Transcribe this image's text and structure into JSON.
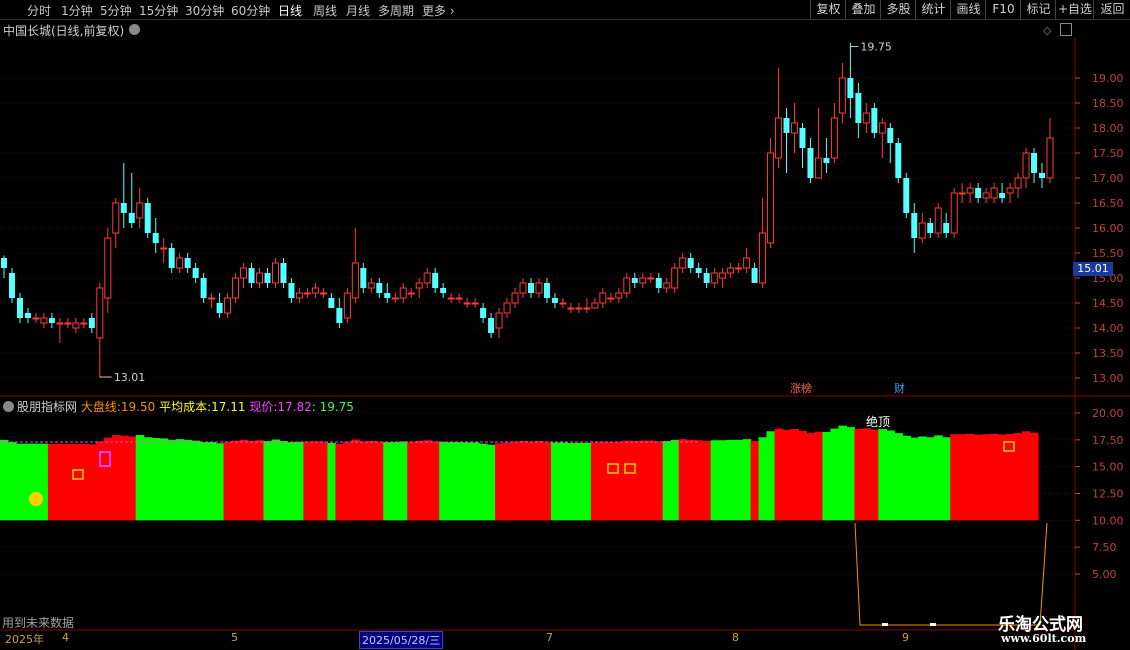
{
  "toolbar": {
    "periods": [
      "分时",
      "1分钟",
      "5分钟",
      "15分钟",
      "30分钟",
      "60分钟",
      "日线",
      "周线",
      "月线",
      "多周期",
      "更多"
    ],
    "active": "日线",
    "right_buttons": [
      "复权",
      "叠加",
      "多股",
      "统计",
      "画线",
      "F10",
      "标记",
      "+自选",
      "返回"
    ]
  },
  "chart": {
    "title": "中国长城(日线,前复权)",
    "current_price_label": "15.01",
    "high_marker": "19.75",
    "low_marker": "13.01",
    "event_labels": [
      "涨榜",
      "财"
    ]
  },
  "indicator": {
    "name": "股朋指标网",
    "dapanxian_label": "大盘线:",
    "dapanxian_value": "19.50",
    "avgcost_label": "平均成本:",
    "avgcost_value": "17.11",
    "price_label": "现价:",
    "price_value": "17.82",
    "last_value": ": 19.75",
    "annotation_top": "绝顶",
    "future_note": "用到未来数据"
  },
  "dates": {
    "year": "2025年",
    "months": [
      "4",
      "5",
      "7",
      "8",
      "9"
    ],
    "cursor_date": "2025/05/28/三"
  },
  "watermark": {
    "line1": "乐淘公式网",
    "line2": "www.60lt.com"
  },
  "colors": {
    "up": "#ff3a3a",
    "down": "#54ffff",
    "green": "#00ff00",
    "red": "#ff0000",
    "grid": "#8b0000",
    "axis_text": "#c04040"
  },
  "chart_data": {
    "type": "candlestick",
    "price_axis_ticks": [
      19.0,
      18.5,
      18.0,
      17.5,
      17.0,
      16.5,
      16.0,
      15.5,
      15.0,
      14.5,
      14.0,
      13.5,
      13.0
    ],
    "indicator_axis_ticks": [
      20.0,
      17.5,
      15.0,
      12.5,
      10.0,
      7.5,
      5.0
    ],
    "ylim": [
      12.9,
      19.8
    ],
    "candles": [
      [
        15.4,
        15.2,
        15.45,
        15.0
      ],
      [
        15.1,
        14.6,
        15.2,
        14.5
      ],
      [
        14.6,
        14.2,
        14.7,
        14.1
      ],
      [
        14.3,
        14.2,
        14.4,
        14.1
      ],
      [
        14.2,
        14.2,
        14.3,
        14.1
      ],
      [
        14.1,
        14.2,
        14.3,
        14.0
      ],
      [
        14.2,
        14.1,
        14.3,
        14.0
      ],
      [
        14.1,
        14.1,
        14.2,
        13.7
      ],
      [
        14.1,
        14.1,
        14.2,
        14.0
      ],
      [
        14.0,
        14.1,
        14.2,
        13.9
      ],
      [
        14.1,
        14.1,
        14.2,
        14.0
      ],
      [
        14.2,
        14.0,
        14.3,
        13.9
      ],
      [
        13.8,
        14.8,
        14.9,
        13.0
      ],
      [
        14.6,
        15.8,
        16.0,
        14.3
      ],
      [
        15.9,
        16.5,
        16.6,
        15.6
      ],
      [
        16.5,
        16.3,
        17.3,
        16.0
      ],
      [
        16.3,
        16.1,
        17.1,
        16.0
      ],
      [
        16.2,
        16.5,
        16.8,
        16.0
      ],
      [
        16.5,
        15.9,
        16.6,
        15.8
      ],
      [
        15.9,
        15.7,
        16.2,
        15.5
      ],
      [
        15.6,
        15.6,
        15.8,
        15.3
      ],
      [
        15.6,
        15.2,
        15.7,
        15.1
      ],
      [
        15.2,
        15.4,
        15.5,
        15.1
      ],
      [
        15.4,
        15.2,
        15.5,
        15.1
      ],
      [
        15.2,
        15.0,
        15.3,
        14.9
      ],
      [
        15.0,
        14.6,
        15.1,
        14.5
      ],
      [
        14.6,
        14.6,
        14.7,
        14.4
      ],
      [
        14.5,
        14.3,
        14.7,
        14.2
      ],
      [
        14.3,
        14.6,
        14.7,
        14.2
      ],
      [
        14.6,
        15.0,
        15.1,
        14.5
      ],
      [
        15.0,
        15.2,
        15.3,
        14.8
      ],
      [
        15.2,
        14.9,
        15.3,
        14.8
      ],
      [
        14.9,
        15.1,
        15.2,
        14.8
      ],
      [
        15.1,
        14.9,
        15.2,
        14.8
      ],
      [
        14.9,
        15.3,
        15.4,
        14.8
      ],
      [
        15.3,
        14.9,
        15.4,
        14.8
      ],
      [
        14.9,
        14.6,
        15.0,
        14.5
      ],
      [
        14.6,
        14.7,
        14.8,
        14.5
      ],
      [
        14.7,
        14.7,
        14.8,
        14.6
      ],
      [
        14.7,
        14.8,
        14.9,
        14.6
      ],
      [
        14.7,
        14.7,
        14.8,
        14.6
      ],
      [
        14.6,
        14.4,
        14.7,
        14.4
      ],
      [
        14.4,
        14.1,
        14.6,
        14.0
      ],
      [
        14.2,
        14.7,
        14.8,
        14.1
      ],
      [
        14.6,
        15.3,
        16.0,
        14.5
      ],
      [
        15.2,
        14.8,
        15.3,
        14.7
      ],
      [
        14.8,
        14.9,
        15.0,
        14.7
      ],
      [
        14.9,
        14.7,
        15.0,
        14.6
      ],
      [
        14.7,
        14.6,
        14.9,
        14.5
      ],
      [
        14.6,
        14.6,
        14.7,
        14.5
      ],
      [
        14.6,
        14.8,
        14.9,
        14.5
      ],
      [
        14.7,
        14.7,
        14.8,
        14.6
      ],
      [
        14.8,
        14.9,
        15.0,
        14.6
      ],
      [
        14.9,
        15.1,
        15.2,
        14.8
      ],
      [
        15.1,
        14.8,
        15.2,
        14.7
      ],
      [
        14.8,
        14.7,
        14.9,
        14.6
      ],
      [
        14.6,
        14.6,
        14.7,
        14.5
      ],
      [
        14.6,
        14.6,
        14.7,
        14.5
      ],
      [
        14.5,
        14.5,
        14.6,
        14.4
      ],
      [
        14.5,
        14.5,
        14.6,
        14.4
      ],
      [
        14.4,
        14.2,
        14.5,
        14.1
      ],
      [
        14.2,
        13.9,
        14.3,
        13.8
      ],
      [
        14.0,
        14.3,
        14.4,
        13.8
      ],
      [
        14.3,
        14.5,
        14.6,
        14.2
      ],
      [
        14.5,
        14.7,
        14.8,
        14.4
      ],
      [
        14.7,
        14.9,
        15.0,
        14.6
      ],
      [
        14.9,
        14.7,
        15.0,
        14.6
      ],
      [
        14.7,
        14.9,
        15.0,
        14.6
      ],
      [
        14.9,
        14.6,
        15.0,
        14.5
      ],
      [
        14.6,
        14.5,
        14.7,
        14.4
      ],
      [
        14.5,
        14.5,
        14.6,
        14.4
      ],
      [
        14.4,
        14.4,
        14.5,
        14.3
      ],
      [
        14.4,
        14.4,
        14.5,
        14.3
      ],
      [
        14.4,
        14.4,
        14.6,
        14.3
      ],
      [
        14.4,
        14.5,
        14.6,
        14.4
      ],
      [
        14.5,
        14.7,
        14.8,
        14.4
      ],
      [
        14.6,
        14.6,
        14.7,
        14.5
      ],
      [
        14.6,
        14.7,
        14.8,
        14.5
      ],
      [
        14.7,
        15.0,
        15.1,
        14.6
      ],
      [
        15.0,
        14.9,
        15.1,
        14.8
      ],
      [
        14.9,
        15.0,
        15.1,
        14.8
      ],
      [
        15.0,
        15.0,
        15.1,
        14.9
      ],
      [
        15.0,
        14.8,
        15.1,
        14.7
      ],
      [
        14.8,
        14.9,
        15.0,
        14.7
      ],
      [
        14.8,
        15.2,
        15.3,
        14.7
      ],
      [
        15.2,
        15.4,
        15.5,
        15.1
      ],
      [
        15.4,
        15.2,
        15.5,
        15.1
      ],
      [
        15.2,
        15.1,
        15.3,
        15.0
      ],
      [
        15.1,
        14.9,
        15.2,
        14.8
      ],
      [
        14.9,
        15.1,
        15.2,
        14.8
      ],
      [
        15.0,
        15.1,
        15.2,
        14.8
      ],
      [
        15.1,
        15.2,
        15.3,
        15.0
      ],
      [
        15.2,
        15.2,
        15.3,
        15.1
      ],
      [
        15.2,
        15.4,
        15.6,
        15.1
      ],
      [
        15.2,
        14.9,
        15.3,
        14.9
      ],
      [
        14.9,
        15.9,
        16.6,
        14.8
      ],
      [
        15.7,
        17.5,
        17.8,
        15.6
      ],
      [
        17.4,
        18.2,
        19.2,
        17.2
      ],
      [
        18.2,
        17.9,
        18.4,
        17.1
      ],
      [
        17.9,
        18.1,
        18.5,
        17.5
      ],
      [
        18.0,
        17.6,
        18.1,
        17.2
      ],
      [
        17.6,
        17.0,
        17.8,
        16.9
      ],
      [
        17.0,
        17.4,
        18.4,
        17.0
      ],
      [
        17.4,
        17.3,
        17.8,
        17.1
      ],
      [
        17.4,
        18.2,
        18.5,
        17.3
      ],
      [
        18.3,
        19.0,
        19.3,
        18.1
      ],
      [
        19.0,
        18.6,
        19.7,
        18.2
      ],
      [
        18.7,
        18.1,
        18.9,
        17.8
      ],
      [
        18.1,
        18.3,
        18.5,
        17.9
      ],
      [
        18.4,
        17.9,
        18.5,
        17.8
      ],
      [
        17.9,
        18.1,
        18.2,
        17.4
      ],
      [
        18.0,
        17.7,
        18.1,
        17.3
      ],
      [
        17.7,
        17.0,
        17.8,
        16.9
      ],
      [
        17.0,
        16.3,
        17.1,
        16.2
      ],
      [
        16.3,
        15.8,
        16.5,
        15.5
      ],
      [
        15.8,
        16.1,
        16.3,
        15.7
      ],
      [
        16.1,
        15.9,
        16.2,
        15.8
      ],
      [
        15.9,
        16.4,
        16.5,
        15.8
      ],
      [
        16.1,
        15.9,
        16.3,
        15.8
      ],
      [
        15.9,
        16.7,
        16.8,
        15.8
      ],
      [
        16.7,
        16.7,
        16.9,
        16.5
      ],
      [
        16.7,
        16.8,
        16.9,
        16.5
      ],
      [
        16.8,
        16.6,
        16.9,
        16.5
      ],
      [
        16.6,
        16.7,
        16.8,
        16.5
      ],
      [
        16.6,
        16.8,
        16.9,
        16.5
      ],
      [
        16.7,
        16.6,
        16.9,
        16.5
      ],
      [
        16.7,
        16.8,
        16.9,
        16.5
      ],
      [
        16.8,
        17.0,
        17.1,
        16.6
      ],
      [
        17.0,
        17.5,
        17.6,
        16.8
      ],
      [
        17.5,
        17.1,
        17.6,
        16.9
      ],
      [
        17.1,
        17.0,
        17.3,
        16.8
      ],
      [
        17.0,
        17.8,
        18.2,
        16.9
      ]
    ],
    "indicator_bands": [
      {
        "color": "green",
        "from": 0,
        "to": 6
      },
      {
        "color": "red",
        "from": 6,
        "to": 17
      },
      {
        "color": "green",
        "from": 17,
        "to": 28
      },
      {
        "color": "red",
        "from": 28,
        "to": 33
      },
      {
        "color": "green",
        "from": 33,
        "to": 38
      },
      {
        "color": "red",
        "from": 38,
        "to": 41
      },
      {
        "color": "green",
        "from": 41,
        "to": 42
      },
      {
        "color": "red",
        "from": 42,
        "to": 48
      },
      {
        "color": "green",
        "from": 48,
        "to": 51
      },
      {
        "color": "red",
        "from": 51,
        "to": 55
      },
      {
        "color": "green",
        "from": 55,
        "to": 62
      },
      {
        "color": "red",
        "from": 62,
        "to": 69
      },
      {
        "color": "green",
        "from": 69,
        "to": 74
      },
      {
        "color": "red",
        "from": 74,
        "to": 83
      },
      {
        "color": "green",
        "from": 83,
        "to": 85
      },
      {
        "color": "red",
        "from": 85,
        "to": 89
      },
      {
        "color": "green",
        "from": 89,
        "to": 94
      },
      {
        "color": "red",
        "from": 94,
        "to": 95
      },
      {
        "color": "green",
        "from": 95,
        "to": 97
      },
      {
        "color": "red",
        "from": 97,
        "to": 103
      },
      {
        "color": "green",
        "from": 103,
        "to": 107
      },
      {
        "color": "red",
        "from": 107,
        "to": 110
      },
      {
        "color": "green",
        "from": 110,
        "to": 119
      },
      {
        "color": "red",
        "from": 119,
        "to": 130
      }
    ]
  }
}
